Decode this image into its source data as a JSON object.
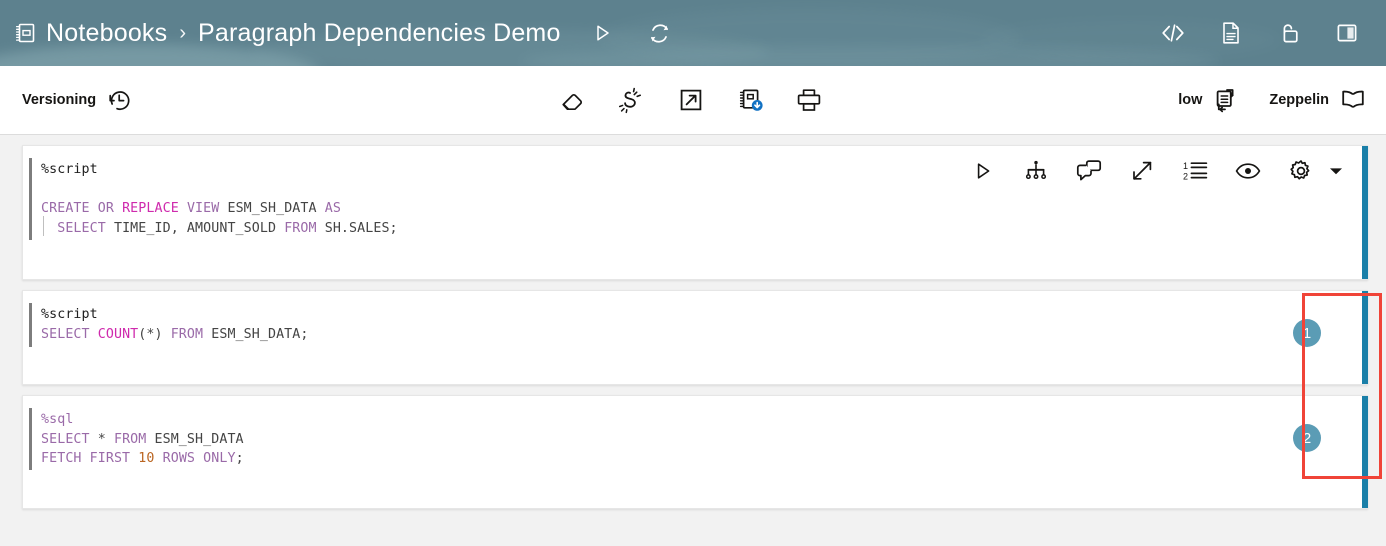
{
  "header": {
    "notebook_icon": "notebook-icon",
    "breadcrumb": {
      "root": "Notebooks",
      "separator": "›",
      "current": "Paragraph Dependencies Demo"
    },
    "actions": [
      {
        "name": "run-all-button",
        "icon": "play-triangle-icon",
        "label": ""
      },
      {
        "name": "refresh-button",
        "icon": "refresh-icon",
        "label": ""
      }
    ],
    "right_actions": [
      {
        "name": "code-view-button",
        "icon": "code-brackets-icon"
      },
      {
        "name": "document-button",
        "icon": "document-icon"
      },
      {
        "name": "unlock-button",
        "icon": "unlock-padlock-icon"
      },
      {
        "name": "layout-split-button",
        "icon": "split-panel-icon"
      }
    ],
    "background_color": "#5d818e",
    "text_color": "#ffffff"
  },
  "toolbar": {
    "versioning_label": "Versioning",
    "versioning_icon": "clock-history-icon",
    "center_actions": [
      {
        "name": "clear-results-button",
        "icon": "eraser-icon"
      },
      {
        "name": "clear-all-output-button",
        "icon": "clear-sparkle-icon"
      },
      {
        "name": "export-button",
        "icon": "external-link-icon"
      },
      {
        "name": "download-notebook-button",
        "icon": "notebook-download-icon"
      },
      {
        "name": "print-button",
        "icon": "printer-icon"
      }
    ],
    "priority_label": "low",
    "priority_icon": "job-flow-icon",
    "interpreter_label": "Zeppelin",
    "interpreter_icon": "open-book-icon"
  },
  "paragraph_toolbar": [
    {
      "name": "run-paragraph-button",
      "icon": "play-triangle-icon"
    },
    {
      "name": "dependencies-button",
      "icon": "dependency-tree-icon"
    },
    {
      "name": "comment-button",
      "icon": "comment-bubbles-icon"
    },
    {
      "name": "expand-button",
      "icon": "expand-diagonal-icon"
    },
    {
      "name": "line-numbers-button",
      "icon": "line-numbers-icon"
    },
    {
      "name": "visibility-button",
      "icon": "eye-icon"
    },
    {
      "name": "settings-button",
      "icon": "gear-icon"
    },
    {
      "name": "more-menu-button",
      "icon": "chevron-down-icon"
    }
  ],
  "paragraphs": [
    {
      "id": "paragraph-1",
      "badge": null,
      "interpreter": "%script",
      "interpreter_style": "plain",
      "lines": [
        [
          {
            "t": "%script",
            "c": "mag"
          }
        ],
        [],
        [
          {
            "t": "CREATE",
            "c": "kw"
          },
          {
            "t": " ",
            "c": ""
          },
          {
            "t": "OR",
            "c": "kw"
          },
          {
            "t": " ",
            "c": ""
          },
          {
            "t": "REPLACE",
            "c": "kwb"
          },
          {
            "t": " ",
            "c": ""
          },
          {
            "t": "VIEW",
            "c": "kw"
          },
          {
            "t": " ESM_SH_DATA ",
            "c": ""
          },
          {
            "t": "AS",
            "c": "kw"
          }
        ],
        [
          {
            "t": "  ",
            "c": ""
          },
          {
            "t": "SELECT",
            "c": "kw"
          },
          {
            "t": " TIME_ID, AMOUNT_SOLD ",
            "c": ""
          },
          {
            "t": "FROM",
            "c": "kw"
          },
          {
            "t": " SH.SALES;",
            "c": ""
          }
        ]
      ]
    },
    {
      "id": "paragraph-2",
      "badge": "1",
      "interpreter": "%script",
      "interpreter_style": "plain",
      "lines": [
        [
          {
            "t": "%script",
            "c": "mag"
          }
        ],
        [
          {
            "t": "SELECT",
            "c": "kw"
          },
          {
            "t": " ",
            "c": ""
          },
          {
            "t": "COUNT",
            "c": "kwb"
          },
          {
            "t": "(*) ",
            "c": ""
          },
          {
            "t": "FROM",
            "c": "kw"
          },
          {
            "t": " ESM_SH_DATA;",
            "c": ""
          }
        ]
      ]
    },
    {
      "id": "paragraph-3",
      "badge": "2",
      "interpreter": "%sql",
      "interpreter_style": "keyword",
      "lines": [
        [
          {
            "t": "%sql",
            "c": "magp"
          }
        ],
        [
          {
            "t": "SELECT",
            "c": "kw"
          },
          {
            "t": " * ",
            "c": ""
          },
          {
            "t": "FROM",
            "c": "kw"
          },
          {
            "t": " ESM_SH_DATA",
            "c": ""
          }
        ],
        [
          {
            "t": "FETCH",
            "c": "kw"
          },
          {
            "t": " ",
            "c": ""
          },
          {
            "t": "FIRST",
            "c": "kw"
          },
          {
            "t": " ",
            "c": ""
          },
          {
            "t": "10",
            "c": "num"
          },
          {
            "t": " ",
            "c": ""
          },
          {
            "t": "ROWS",
            "c": "kw"
          },
          {
            "t": " ",
            "c": ""
          },
          {
            "t": "ONLY",
            "c": "kw"
          },
          {
            "t": ";",
            "c": ""
          }
        ]
      ]
    }
  ],
  "annotation": {
    "name": "highlight-rectangle",
    "color": "#f04438",
    "covers": [
      "paragraph-2",
      "paragraph-3"
    ]
  },
  "colors": {
    "header_bg": "#5d818e",
    "accent_bar": "#1a7fa8",
    "badge_bg": "#5b9cb5",
    "annotation": "#f04438",
    "keyword": "#9a6aa8",
    "keyword_bold": "#cf2aad",
    "number": "#bb6622",
    "code_text": "#444444"
  }
}
